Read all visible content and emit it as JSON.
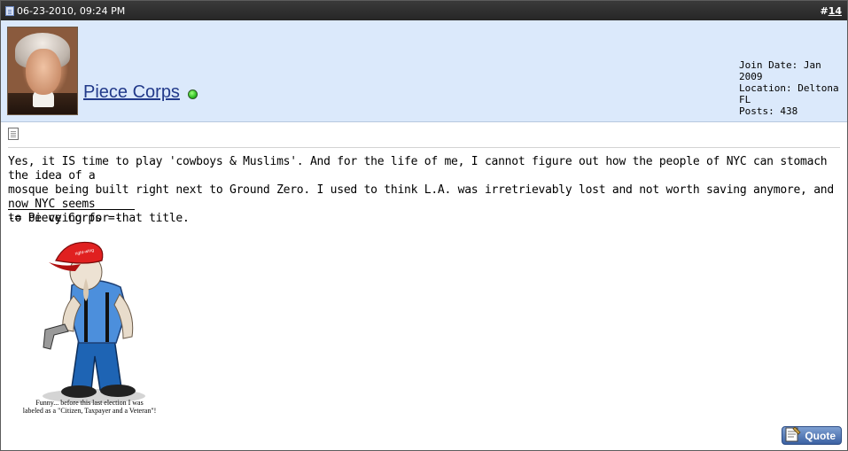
{
  "post": {
    "date": "06-23-2010, 09:24 PM",
    "number_prefix": "#",
    "number": "14"
  },
  "user": {
    "name": "Piece Corps",
    "online": true,
    "join_date": "Join Date: Jan 2009",
    "location": "Location: Deltona FL",
    "posts": "Posts: 438"
  },
  "message": {
    "line1": "Yes, it IS time to play 'cowboys & Muslims'. And for the life of me, I cannot figure out how the people of NYC can stomach the idea of a",
    "line2": "mosque being built right next to Ground Zero. I used to think L.A. was irretrievably lost and not worth saving anymore, and now NYC seems",
    "line3": "to be vying for that title."
  },
  "signature": {
    "text": "-= Piece Corps =-",
    "caption_line1": "Funny... before this last election I was",
    "caption_line2": "labeled as a \"Citizen, Taxpayer and a Veteran\"!"
  },
  "buttons": {
    "quote_label": "Quote"
  },
  "colors": {
    "header_bg": "#2f2f2f",
    "user_bar_bg": "#dbe9fb",
    "username_link": "#223a8a"
  }
}
